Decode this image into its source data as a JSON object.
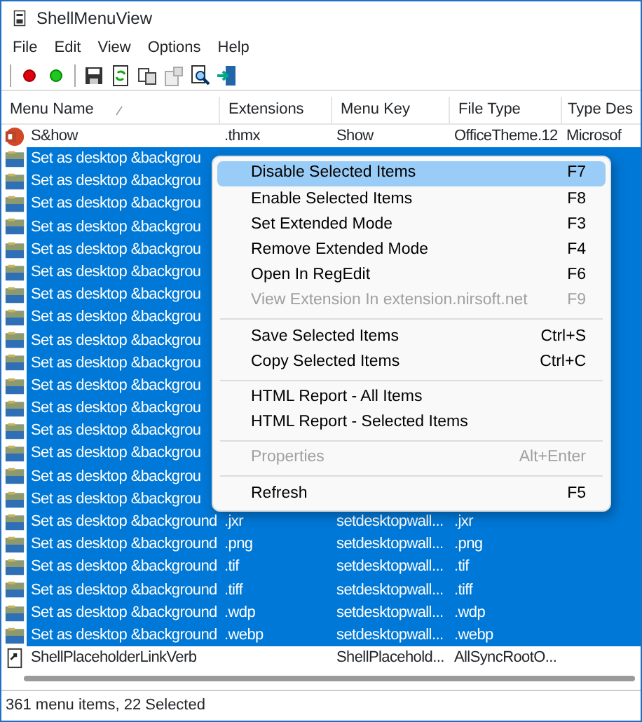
{
  "window": {
    "title": "ShellMenuView"
  },
  "menu_bar": [
    "File",
    "Edit",
    "View",
    "Options",
    "Help"
  ],
  "table": {
    "columns": [
      {
        "label": "Menu Name",
        "sorted": true
      },
      {
        "label": "Extensions"
      },
      {
        "label": "Menu Key"
      },
      {
        "label": "File Type"
      },
      {
        "label": "Type Des"
      }
    ],
    "rows": [
      {
        "kind": "theme",
        "selected": false,
        "cells": [
          "S&how",
          ".thmx",
          "Show",
          "OfficeTheme.12",
          "Microsof"
        ]
      },
      {
        "kind": "wallpaper",
        "selected": true,
        "cells": [
          "Set as desktop &backgrou"
        ]
      },
      {
        "kind": "wallpaper",
        "selected": true,
        "cells": [
          "Set as desktop &backgrou"
        ]
      },
      {
        "kind": "wallpaper",
        "selected": true,
        "cells": [
          "Set as desktop &backgrou"
        ]
      },
      {
        "kind": "wallpaper",
        "selected": true,
        "cells": [
          "Set as desktop &backgrou"
        ]
      },
      {
        "kind": "wallpaper",
        "selected": true,
        "cells": [
          "Set as desktop &backgrou"
        ]
      },
      {
        "kind": "wallpaper",
        "selected": true,
        "cells": [
          "Set as desktop &backgrou"
        ]
      },
      {
        "kind": "wallpaper",
        "selected": true,
        "cells": [
          "Set as desktop &backgrou"
        ]
      },
      {
        "kind": "wallpaper",
        "selected": true,
        "cells": [
          "Set as desktop &backgrou"
        ]
      },
      {
        "kind": "wallpaper",
        "selected": true,
        "cells": [
          "Set as desktop &backgrou"
        ]
      },
      {
        "kind": "wallpaper",
        "selected": true,
        "cells": [
          "Set as desktop &backgrou"
        ]
      },
      {
        "kind": "wallpaper",
        "selected": true,
        "cells": [
          "Set as desktop &backgrou"
        ]
      },
      {
        "kind": "wallpaper",
        "selected": true,
        "cells": [
          "Set as desktop &backgrou"
        ]
      },
      {
        "kind": "wallpaper",
        "selected": true,
        "cells": [
          "Set as desktop &backgrou"
        ]
      },
      {
        "kind": "wallpaper",
        "selected": true,
        "cells": [
          "Set as desktop &backgrou"
        ]
      },
      {
        "kind": "wallpaper",
        "selected": true,
        "cells": [
          "Set as desktop &backgrou"
        ]
      },
      {
        "kind": "wallpaper",
        "selected": true,
        "cells": [
          "Set as desktop &backgrou"
        ]
      },
      {
        "kind": "wallpaper",
        "selected": true,
        "cells": [
          "Set as desktop &background",
          ".jxr",
          "setdesktopwall...",
          ".jxr"
        ]
      },
      {
        "kind": "wallpaper",
        "selected": true,
        "cells": [
          "Set as desktop &background",
          ".png",
          "setdesktopwall...",
          ".png"
        ]
      },
      {
        "kind": "wallpaper",
        "selected": true,
        "cells": [
          "Set as desktop &background",
          ".tif",
          "setdesktopwall...",
          ".tif"
        ]
      },
      {
        "kind": "wallpaper",
        "selected": true,
        "cells": [
          "Set as desktop &background",
          ".tiff",
          "setdesktopwall...",
          ".tiff"
        ]
      },
      {
        "kind": "wallpaper",
        "selected": true,
        "cells": [
          "Set as desktop &background",
          ".wdp",
          "setdesktopwall...",
          ".wdp"
        ]
      },
      {
        "kind": "wallpaper",
        "selected": true,
        "cells": [
          "Set as desktop &background",
          ".webp",
          "setdesktopwall...",
          ".webp"
        ]
      },
      {
        "kind": "link",
        "selected": false,
        "cells": [
          "ShellPlaceholderLinkVerb",
          "",
          "ShellPlacehold...",
          "AllSyncRootO..."
        ]
      }
    ]
  },
  "context_menu": {
    "items": [
      {
        "kind": "item",
        "label": "Disable Selected Items",
        "shortcut": "F7",
        "disabled": false,
        "selected": true
      },
      {
        "kind": "item",
        "label": "Enable Selected Items",
        "shortcut": "F8",
        "disabled": false,
        "selected": false
      },
      {
        "kind": "item",
        "label": "Set Extended Mode",
        "shortcut": "F3",
        "disabled": false,
        "selected": false
      },
      {
        "kind": "item",
        "label": "Remove Extended Mode",
        "shortcut": "F4",
        "disabled": false,
        "selected": false
      },
      {
        "kind": "item",
        "label": "Open In RegEdit",
        "shortcut": "F6",
        "disabled": false,
        "selected": false
      },
      {
        "kind": "item",
        "label": "View Extension In extension.nirsoft.net",
        "shortcut": "F9",
        "disabled": true,
        "selected": false
      },
      {
        "kind": "separator"
      },
      {
        "kind": "item",
        "label": "Save Selected Items",
        "shortcut": "Ctrl+S",
        "disabled": false,
        "selected": false
      },
      {
        "kind": "item",
        "label": "Copy Selected Items",
        "shortcut": "Ctrl+C",
        "disabled": false,
        "selected": false
      },
      {
        "kind": "separator"
      },
      {
        "kind": "item",
        "label": "HTML Report - All Items",
        "disabled": false,
        "selected": false
      },
      {
        "kind": "item",
        "label": "HTML Report - Selected Items",
        "disabled": false,
        "selected": false
      },
      {
        "kind": "separator"
      },
      {
        "kind": "item",
        "label": "Properties",
        "shortcut": "Alt+Enter",
        "disabled": true,
        "selected": false
      },
      {
        "kind": "separator"
      },
      {
        "kind": "item",
        "label": "Refresh",
        "shortcut": "F5",
        "disabled": false,
        "selected": false
      }
    ]
  },
  "status_bar": "361 menu items, 22 Selected"
}
